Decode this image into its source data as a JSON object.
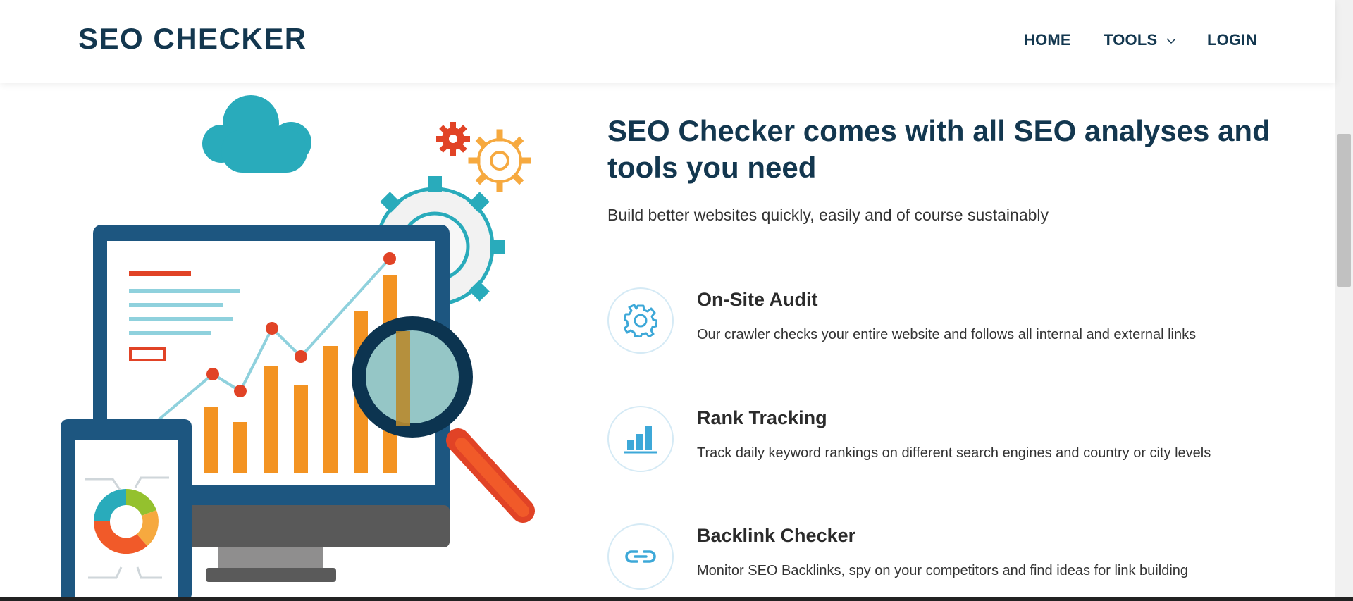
{
  "header": {
    "logo": "SEO CHECKER",
    "nav": {
      "home": "HOME",
      "tools": "TOOLS",
      "login": "LOGIN"
    }
  },
  "hero": {
    "title": "SEO Checker comes with all SEO analyses and tools you need",
    "subtitle": "Build better websites quickly, easily and of course sustainably"
  },
  "features": [
    {
      "title": "On-Site Audit",
      "description": "Our crawler checks your entire website and follows all internal and external links",
      "icon": "gear-icon"
    },
    {
      "title": "Rank Tracking",
      "description": "Track daily keyword rankings on different search engines and country or city levels",
      "icon": "bar-chart-icon"
    },
    {
      "title": "Backlink Checker",
      "description": "Monitor SEO Backlinks, spy on your competitors and find ideas for link building",
      "icon": "link-icon"
    }
  ],
  "colors": {
    "brand_navy": "#13374f",
    "accent_blue": "#3da8d8",
    "bar_orange": "#f39322",
    "marker_red": "#e14326",
    "cloud_teal": "#29abbb"
  }
}
